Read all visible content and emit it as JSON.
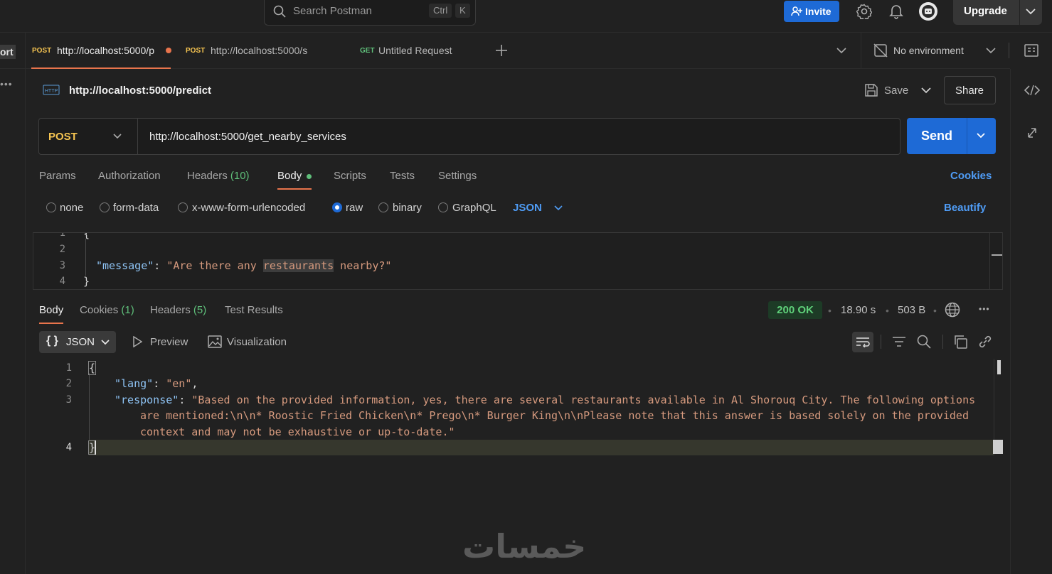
{
  "topbar": {
    "search_placeholder": "Search Postman",
    "shortcut_ctrl": "Ctrl",
    "shortcut_k": "K",
    "invite_label": "Invite",
    "upgrade_label": "Upgrade"
  },
  "sidebar": {
    "cut_label": "ort"
  },
  "tabs": [
    {
      "method": "POST",
      "url": "http://localhost:5000/p",
      "active": true,
      "unsaved": true
    },
    {
      "method": "POST",
      "url": "http://localhost:5000/s",
      "active": false
    },
    {
      "method": "GET",
      "url": "Untitled Request",
      "active": false
    }
  ],
  "environment": {
    "label": "No environment"
  },
  "request": {
    "title": "http://localhost:5000/predict",
    "save_label": "Save",
    "share_label": "Share",
    "method": "POST",
    "url": "http://localhost:5000/get_nearby_services",
    "send_label": "Send",
    "subtabs": {
      "params": "Params",
      "authorization": "Authorization",
      "headers": "Headers",
      "headers_count": "(10)",
      "body": "Body",
      "scripts": "Scripts",
      "tests": "Tests",
      "settings": "Settings",
      "cookies": "Cookies"
    },
    "body_types": {
      "none": "none",
      "form_data": "form-data",
      "urlencoded": "x-www-form-urlencoded",
      "raw": "raw",
      "binary": "binary",
      "graphql": "GraphQL",
      "format": "JSON",
      "beautify": "Beautify"
    },
    "body_lines": {
      "n1": "1",
      "n2": "2",
      "n3": "3",
      "n4": "4",
      "open": "{",
      "key": "\"message\"",
      "colon": ": ",
      "val_a": "\"Are there any ",
      "val_hl": "restaurants",
      "val_b": " nearby?\"",
      "close": "}"
    }
  },
  "response": {
    "tabs": {
      "body": "Body",
      "cookies": "Cookies",
      "cookies_count": "(1)",
      "headers": "Headers",
      "headers_count": "(5)",
      "test_results": "Test Results"
    },
    "status": "200 OK",
    "time": "18.90 s",
    "size": "503 B",
    "format": "JSON",
    "preview_label": "Preview",
    "visualization_label": "Visualization",
    "lines": {
      "n1": "1",
      "n2": "2",
      "n3": "3",
      "n4": "4",
      "open": "{",
      "lang_key": "\"lang\"",
      "lang_val": "\"en\"",
      "resp_key": "\"response\"",
      "resp_val_1": "\"Based on the provided information, yes, there are several restaurants available in Al Shorouq City. The following options",
      "resp_val_2": "are mentioned:\\n\\n* Roostic Fried Chicken\\n* Prego\\n* Burger King\\n\\nPlease note that this answer is based solely on the provided",
      "resp_val_3": "context and may not be exhaustive or up-to-date.\"",
      "close": "}"
    }
  },
  "watermark": "خمسات",
  "colors": {
    "accent": "#1e6ad6",
    "post": "#f5c451",
    "get": "#5fbf7a",
    "tab_underline": "#e8744c",
    "status_ok": "#5fd07a"
  }
}
